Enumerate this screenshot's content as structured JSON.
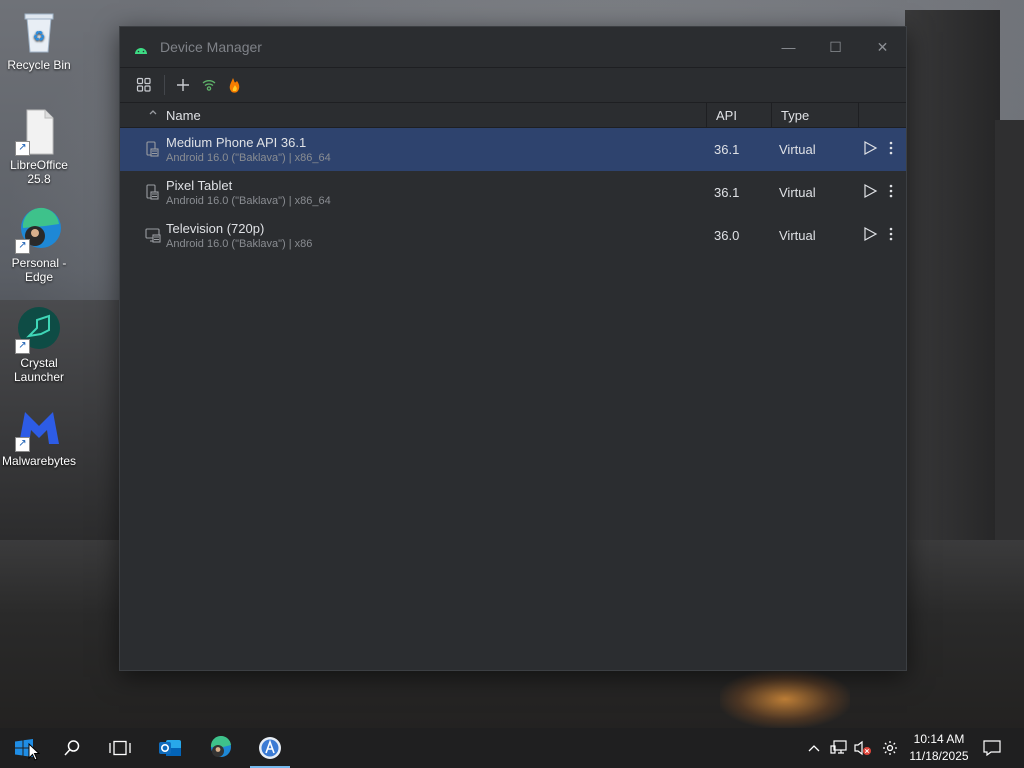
{
  "desktop": {
    "icons": [
      {
        "label": "Recycle Bin"
      },
      {
        "label": "LibreOffice 25.8"
      },
      {
        "label": "Personal - Edge"
      },
      {
        "label": "Crystal Launcher"
      },
      {
        "label": "Malwarebytes"
      }
    ]
  },
  "window": {
    "title": "Device Manager",
    "controls": {
      "minimize": "—",
      "maximize": "☐",
      "close": "✕"
    }
  },
  "toolbar": {
    "buttons": [
      "layout-grid-icon",
      "add-icon",
      "wifi-pair-icon",
      "firebase-icon"
    ]
  },
  "table": {
    "columns": {
      "sort_indicator": "^",
      "name": "Name",
      "api": "API",
      "type": "Type"
    },
    "rows": [
      {
        "name": "Medium Phone API 36.1",
        "sub": "Android 16.0 (\"Baklava\") | x86_64",
        "api": "36.1",
        "type": "Virtual",
        "selected": true,
        "icon": "phone-icon"
      },
      {
        "name": "Pixel Tablet",
        "sub": "Android 16.0 (\"Baklava\") | x86_64",
        "api": "36.1",
        "type": "Virtual",
        "selected": false,
        "icon": "tablet-icon"
      },
      {
        "name": "Television (720p)",
        "sub": "Android 16.0 (\"Baklava\") | x86",
        "api": "36.0",
        "type": "Virtual",
        "selected": false,
        "icon": "tv-icon"
      }
    ]
  },
  "taskbar": {
    "items": [
      "start-icon",
      "search-icon",
      "task-view-icon",
      "outlook-icon",
      "edge-icon",
      "android-studio-icon"
    ],
    "clock_time": "10:14 AM",
    "clock_date": "11/18/2025"
  },
  "colors": {
    "selection": "#2e436e",
    "window_bg": "#2b2d30",
    "taskbar_bg": "#1f1f20"
  }
}
